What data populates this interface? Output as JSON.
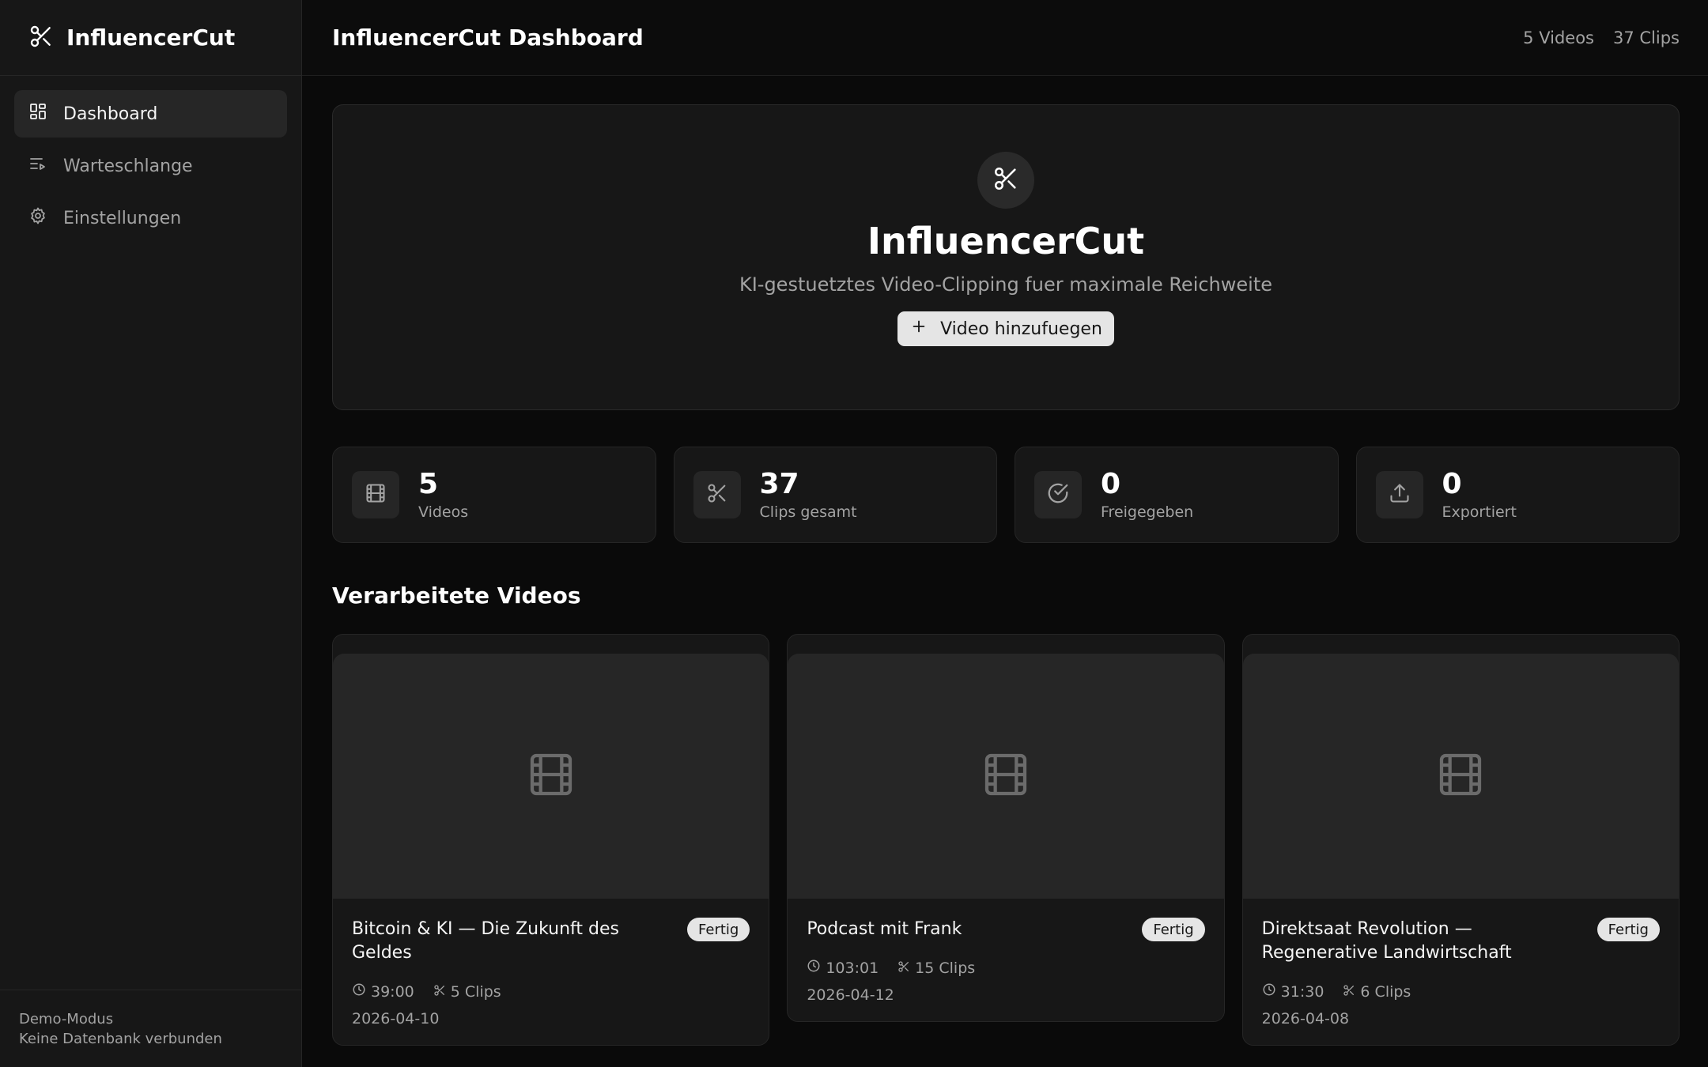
{
  "brand": {
    "name": "InfluencerCut"
  },
  "sidebar": {
    "items": [
      {
        "label": "Dashboard",
        "icon": "grid-icon",
        "active": true
      },
      {
        "label": "Warteschlange",
        "icon": "queue-icon",
        "active": false
      },
      {
        "label": "Einstellungen",
        "icon": "gear-icon",
        "active": false
      }
    ],
    "footer": {
      "mode": "Demo-Modus",
      "db_status": "Keine Datenbank verbunden"
    }
  },
  "topbar": {
    "title": "InfluencerCut Dashboard",
    "videos_count": "5 Videos",
    "clips_count": "37 Clips"
  },
  "hero": {
    "icon": "scissors-icon",
    "title": "InfluencerCut",
    "subtitle": "KI-gestuetztes Video-Clipping fuer maximale Reichweite",
    "button_label": "Video hinzufuegen"
  },
  "stats": [
    {
      "value": "5",
      "label": "Videos",
      "icon": "film-icon"
    },
    {
      "value": "37",
      "label": "Clips gesamt",
      "icon": "scissors-icon"
    },
    {
      "value": "0",
      "label": "Freigegeben",
      "icon": "check-circle-icon"
    },
    {
      "value": "0",
      "label": "Exportiert",
      "icon": "upload-icon"
    }
  ],
  "section": {
    "title": "Verarbeitete Videos"
  },
  "videos": [
    {
      "title": "Bitcoin & KI — Die Zukunft des Geldes",
      "status": "Fertig",
      "duration": "39:00",
      "clips": "5 Clips",
      "date": "2026-04-10"
    },
    {
      "title": "Podcast mit Frank",
      "status": "Fertig",
      "duration": "103:01",
      "clips": "15 Clips",
      "date": "2026-04-12"
    },
    {
      "title": "Direktsaat Revolution — Regenerative Landwirtschaft",
      "status": "Fertig",
      "duration": "31:30",
      "clips": "6 Clips",
      "date": "2026-04-08"
    }
  ],
  "colors": {
    "background": "#0a0a0a",
    "surface": "#171717",
    "surface_alt": "#262626",
    "text": "#f5f5f5",
    "muted": "#a3a3a3",
    "badge_bg": "#e5e5e5"
  }
}
